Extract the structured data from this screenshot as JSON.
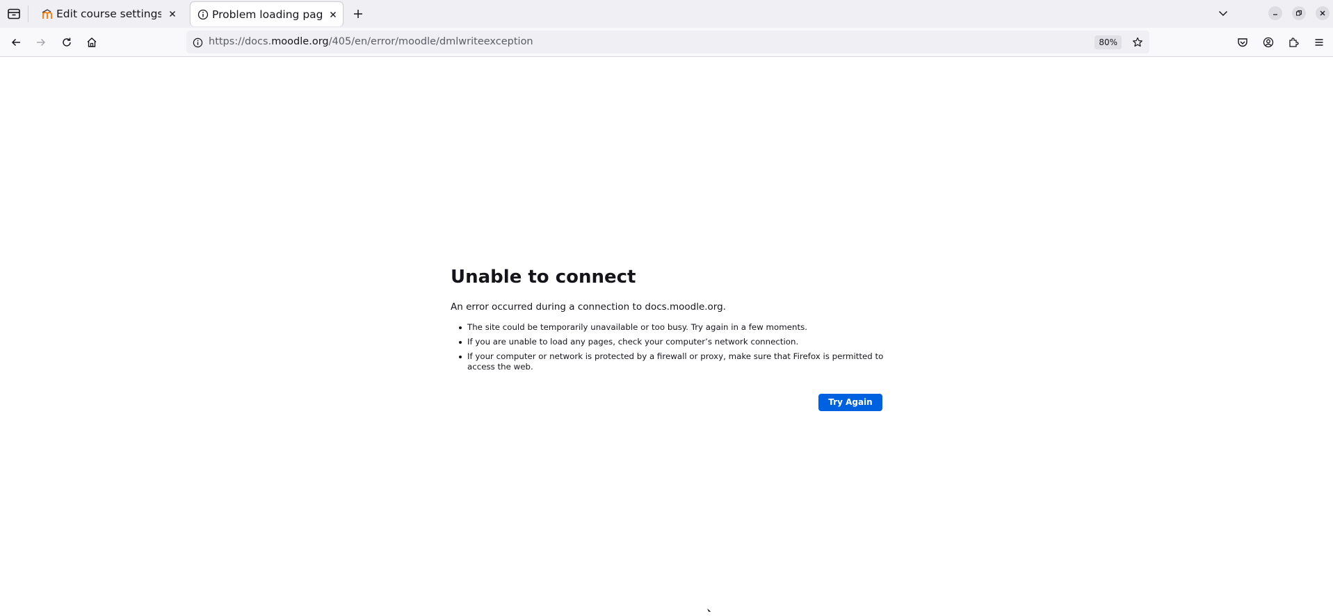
{
  "tabs": [
    {
      "title": "Edit course settings | FDI",
      "favicon": "moodle-favicon-icon",
      "active": false
    },
    {
      "title": "Problem loading page",
      "favicon": "info-icon",
      "active": true
    }
  ],
  "toolbar": {
    "url_scheme": "https://docs.",
    "url_host": "moodle.org",
    "url_path": "/405/en/error/moodle/dmlwriteexception",
    "zoom": "80%"
  },
  "error": {
    "title": "Unable to connect",
    "description": "An error occurred during a connection to docs.moodle.org.",
    "items": [
      "The site could be temporarily unavailable or too busy. Try again in a few moments.",
      "If you are unable to load any pages, check your computer’s network connection.",
      "If your computer or network is protected by a firewall or proxy, make sure that Firefox is permitted to access the web."
    ],
    "button": "Try Again"
  },
  "colors": {
    "accent": "#0061e0",
    "tabstrip": "#f0f0f4",
    "text": "#15141a"
  }
}
